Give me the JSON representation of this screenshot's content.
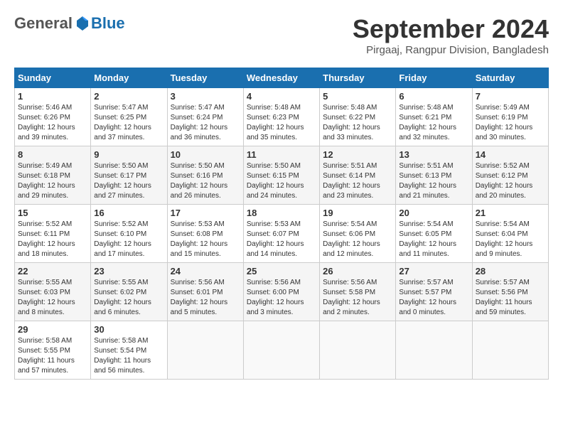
{
  "logo": {
    "general": "General",
    "blue": "Blue"
  },
  "header": {
    "month_title": "September 2024",
    "subtitle": "Pirgaaj, Rangpur Division, Bangladesh"
  },
  "weekdays": [
    "Sunday",
    "Monday",
    "Tuesday",
    "Wednesday",
    "Thursday",
    "Friday",
    "Saturday"
  ],
  "weeks": [
    [
      {
        "day": "1",
        "sunrise": "Sunrise: 5:46 AM",
        "sunset": "Sunset: 6:26 PM",
        "daylight": "Daylight: 12 hours and 39 minutes."
      },
      {
        "day": "2",
        "sunrise": "Sunrise: 5:47 AM",
        "sunset": "Sunset: 6:25 PM",
        "daylight": "Daylight: 12 hours and 37 minutes."
      },
      {
        "day": "3",
        "sunrise": "Sunrise: 5:47 AM",
        "sunset": "Sunset: 6:24 PM",
        "daylight": "Daylight: 12 hours and 36 minutes."
      },
      {
        "day": "4",
        "sunrise": "Sunrise: 5:48 AM",
        "sunset": "Sunset: 6:23 PM",
        "daylight": "Daylight: 12 hours and 35 minutes."
      },
      {
        "day": "5",
        "sunrise": "Sunrise: 5:48 AM",
        "sunset": "Sunset: 6:22 PM",
        "daylight": "Daylight: 12 hours and 33 minutes."
      },
      {
        "day": "6",
        "sunrise": "Sunrise: 5:48 AM",
        "sunset": "Sunset: 6:21 PM",
        "daylight": "Daylight: 12 hours and 32 minutes."
      },
      {
        "day": "7",
        "sunrise": "Sunrise: 5:49 AM",
        "sunset": "Sunset: 6:19 PM",
        "daylight": "Daylight: 12 hours and 30 minutes."
      }
    ],
    [
      {
        "day": "8",
        "sunrise": "Sunrise: 5:49 AM",
        "sunset": "Sunset: 6:18 PM",
        "daylight": "Daylight: 12 hours and 29 minutes."
      },
      {
        "day": "9",
        "sunrise": "Sunrise: 5:50 AM",
        "sunset": "Sunset: 6:17 PM",
        "daylight": "Daylight: 12 hours and 27 minutes."
      },
      {
        "day": "10",
        "sunrise": "Sunrise: 5:50 AM",
        "sunset": "Sunset: 6:16 PM",
        "daylight": "Daylight: 12 hours and 26 minutes."
      },
      {
        "day": "11",
        "sunrise": "Sunrise: 5:50 AM",
        "sunset": "Sunset: 6:15 PM",
        "daylight": "Daylight: 12 hours and 24 minutes."
      },
      {
        "day": "12",
        "sunrise": "Sunrise: 5:51 AM",
        "sunset": "Sunset: 6:14 PM",
        "daylight": "Daylight: 12 hours and 23 minutes."
      },
      {
        "day": "13",
        "sunrise": "Sunrise: 5:51 AM",
        "sunset": "Sunset: 6:13 PM",
        "daylight": "Daylight: 12 hours and 21 minutes."
      },
      {
        "day": "14",
        "sunrise": "Sunrise: 5:52 AM",
        "sunset": "Sunset: 6:12 PM",
        "daylight": "Daylight: 12 hours and 20 minutes."
      }
    ],
    [
      {
        "day": "15",
        "sunrise": "Sunrise: 5:52 AM",
        "sunset": "Sunset: 6:11 PM",
        "daylight": "Daylight: 12 hours and 18 minutes."
      },
      {
        "day": "16",
        "sunrise": "Sunrise: 5:52 AM",
        "sunset": "Sunset: 6:10 PM",
        "daylight": "Daylight: 12 hours and 17 minutes."
      },
      {
        "day": "17",
        "sunrise": "Sunrise: 5:53 AM",
        "sunset": "Sunset: 6:08 PM",
        "daylight": "Daylight: 12 hours and 15 minutes."
      },
      {
        "day": "18",
        "sunrise": "Sunrise: 5:53 AM",
        "sunset": "Sunset: 6:07 PM",
        "daylight": "Daylight: 12 hours and 14 minutes."
      },
      {
        "day": "19",
        "sunrise": "Sunrise: 5:54 AM",
        "sunset": "Sunset: 6:06 PM",
        "daylight": "Daylight: 12 hours and 12 minutes."
      },
      {
        "day": "20",
        "sunrise": "Sunrise: 5:54 AM",
        "sunset": "Sunset: 6:05 PM",
        "daylight": "Daylight: 12 hours and 11 minutes."
      },
      {
        "day": "21",
        "sunrise": "Sunrise: 5:54 AM",
        "sunset": "Sunset: 6:04 PM",
        "daylight": "Daylight: 12 hours and 9 minutes."
      }
    ],
    [
      {
        "day": "22",
        "sunrise": "Sunrise: 5:55 AM",
        "sunset": "Sunset: 6:03 PM",
        "daylight": "Daylight: 12 hours and 8 minutes."
      },
      {
        "day": "23",
        "sunrise": "Sunrise: 5:55 AM",
        "sunset": "Sunset: 6:02 PM",
        "daylight": "Daylight: 12 hours and 6 minutes."
      },
      {
        "day": "24",
        "sunrise": "Sunrise: 5:56 AM",
        "sunset": "Sunset: 6:01 PM",
        "daylight": "Daylight: 12 hours and 5 minutes."
      },
      {
        "day": "25",
        "sunrise": "Sunrise: 5:56 AM",
        "sunset": "Sunset: 6:00 PM",
        "daylight": "Daylight: 12 hours and 3 minutes."
      },
      {
        "day": "26",
        "sunrise": "Sunrise: 5:56 AM",
        "sunset": "Sunset: 5:58 PM",
        "daylight": "Daylight: 12 hours and 2 minutes."
      },
      {
        "day": "27",
        "sunrise": "Sunrise: 5:57 AM",
        "sunset": "Sunset: 5:57 PM",
        "daylight": "Daylight: 12 hours and 0 minutes."
      },
      {
        "day": "28",
        "sunrise": "Sunrise: 5:57 AM",
        "sunset": "Sunset: 5:56 PM",
        "daylight": "Daylight: 11 hours and 59 minutes."
      }
    ],
    [
      {
        "day": "29",
        "sunrise": "Sunrise: 5:58 AM",
        "sunset": "Sunset: 5:55 PM",
        "daylight": "Daylight: 11 hours and 57 minutes."
      },
      {
        "day": "30",
        "sunrise": "Sunrise: 5:58 AM",
        "sunset": "Sunset: 5:54 PM",
        "daylight": "Daylight: 11 hours and 56 minutes."
      },
      null,
      null,
      null,
      null,
      null
    ]
  ]
}
